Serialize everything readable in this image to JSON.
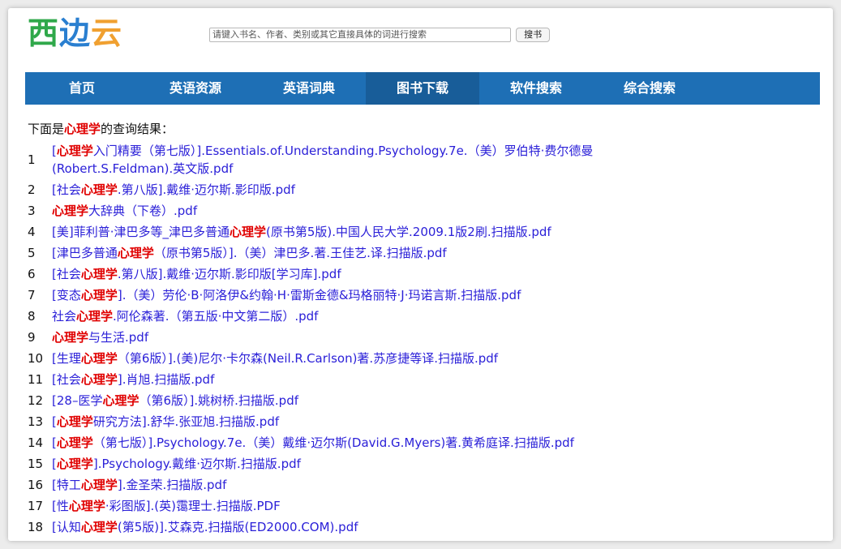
{
  "logo": {
    "char1": "西",
    "char2": "边",
    "char3": "云"
  },
  "search": {
    "placeholder": "请键入书名、作者、类别或其它直接具体的词进行搜索",
    "button_label": "搜书"
  },
  "nav": [
    {
      "label": "首页"
    },
    {
      "label": "英语资源"
    },
    {
      "label": "英语词典"
    },
    {
      "label": "图书下载"
    },
    {
      "label": "软件搜索"
    },
    {
      "label": "综合搜索"
    }
  ],
  "nav_active_index": 3,
  "intro": {
    "prefix": "下面是",
    "keyword": "心理学",
    "suffix": "的查询结果："
  },
  "colors": {
    "nav_bg": "#1e6fb5",
    "nav_active": "#185d99",
    "highlight": "#e00000",
    "link": "#2b20d8"
  },
  "results": [
    {
      "num": "1",
      "pre": "[",
      "hl": "心理学",
      "post": "入门精要（第七版）].Essentials.of.Understanding.Psychology.7e.（美）罗伯特·费尔德曼(Robert.S.Feldman).英文版.pdf"
    },
    {
      "num": "2",
      "pre": "[社会",
      "hl": "心理学",
      "post": ".第八版].戴维·迈尔斯.影印版.pdf"
    },
    {
      "num": "3",
      "pre": "",
      "hl": "心理学",
      "post": "大辞典（下卷）.pdf"
    },
    {
      "num": "4",
      "pre": "[美]菲利普·津巴多等_津巴多普通",
      "hl": "心理学",
      "post": "(原书第5版).中国人民大学.2009.1版2刷.扫描版.pdf"
    },
    {
      "num": "5",
      "pre": "[津巴多普通",
      "hl": "心理学",
      "post": "（原书第5版）].（美）津巴多.著.王佳艺.译.扫描版.pdf"
    },
    {
      "num": "6",
      "pre": "[社会",
      "hl": "心理学",
      "post": ".第八版].戴维·迈尔斯.影印版[学习库].pdf"
    },
    {
      "num": "7",
      "pre": "[变态",
      "hl": "心理学",
      "post": "].（美）劳伦·B·阿洛伊&约翰·H·雷斯金德&玛格丽特·J·玛诺言斯.扫描版.pdf"
    },
    {
      "num": "8",
      "pre": "社会",
      "hl": "心理学",
      "post": ".阿伦森著.（第五版·中文第二版）.pdf"
    },
    {
      "num": "9",
      "pre": "",
      "hl": "心理学",
      "post": "与生活.pdf"
    },
    {
      "num": "10",
      "pre": "[生理",
      "hl": "心理学",
      "post": "（第6版）].(美)尼尔·卡尔森(Neil.R.Carlson)著.苏彦捷等译.扫描版.pdf"
    },
    {
      "num": "11",
      "pre": "[社会",
      "hl": "心理学",
      "post": "].肖旭.扫描版.pdf"
    },
    {
      "num": "12",
      "pre": "[28–医学",
      "hl": "心理学",
      "post": "（第6版）].姚树桥.扫描版.pdf"
    },
    {
      "num": "13",
      "pre": "[",
      "hl": "心理学",
      "post": "研究方法].舒华.张亚旭.扫描版.pdf"
    },
    {
      "num": "14",
      "pre": "[",
      "hl": "心理学",
      "post": "（第七版）].Psychology.7e.（美）戴维·迈尔斯(David.G.Myers)著.黄希庭译.扫描版.pdf"
    },
    {
      "num": "15",
      "pre": "[",
      "hl": "心理学",
      "post": "].Psychology.戴维·迈尔斯.扫描版.pdf"
    },
    {
      "num": "16",
      "pre": "[特工",
      "hl": "心理学",
      "post": "].金圣荣.扫描版.pdf"
    },
    {
      "num": "17",
      "pre": "[性",
      "hl": "心理学",
      "post": "·彩图版].(英)霭理士.扫描版.PDF"
    },
    {
      "num": "18",
      "pre": "[认知",
      "hl": "心理学",
      "post": "(第5版)].艾森克.扫描版(ED2000.COM).pdf"
    }
  ]
}
